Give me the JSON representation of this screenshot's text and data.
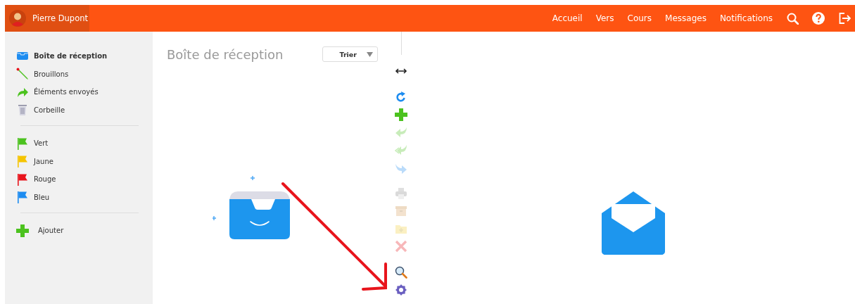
{
  "header": {
    "user": "Pierre Dupont",
    "nav": [
      {
        "label": "Accueil"
      },
      {
        "label": "Vers"
      },
      {
        "label": "Cours"
      },
      {
        "label": "Messages"
      },
      {
        "label": "Notifications"
      }
    ],
    "actions": [
      {
        "kind": "search"
      },
      {
        "kind": "help"
      },
      {
        "kind": "logout"
      }
    ]
  },
  "sidebar": {
    "folders": [
      {
        "kind": "inbox",
        "label": "Boîte de réception",
        "selected": true
      },
      {
        "kind": "drafts",
        "label": "Brouillons",
        "selected": false
      },
      {
        "kind": "sent",
        "label": "Éléments envoyés",
        "selected": false
      },
      {
        "kind": "trash",
        "label": "Corbeille",
        "selected": false
      }
    ],
    "flags": [
      {
        "label": "Vert",
        "color": "#4cc21f"
      },
      {
        "label": "Jaune",
        "color": "#f5c400"
      },
      {
        "label": "Rouge",
        "color": "#e8141c"
      },
      {
        "label": "Bleu",
        "color": "#1d8cf0"
      }
    ],
    "add_label": "Ajouter"
  },
  "list": {
    "title": "Boîte de réception",
    "sort": "Trier"
  },
  "toolbar": [
    {
      "kind": "swap",
      "disabled": false
    },
    {
      "kind": "refresh",
      "disabled": false
    },
    {
      "kind": "new",
      "disabled": false
    },
    {
      "kind": "reply",
      "disabled": true
    },
    {
      "kind": "reply-all",
      "disabled": true
    },
    {
      "kind": "forward",
      "disabled": true
    },
    {
      "kind": "print",
      "disabled": true
    },
    {
      "kind": "archive",
      "disabled": true
    },
    {
      "kind": "move",
      "disabled": true
    },
    {
      "kind": "delete",
      "disabled": true
    },
    {
      "kind": "search",
      "disabled": false
    },
    {
      "kind": "settings",
      "disabled": false
    }
  ]
}
